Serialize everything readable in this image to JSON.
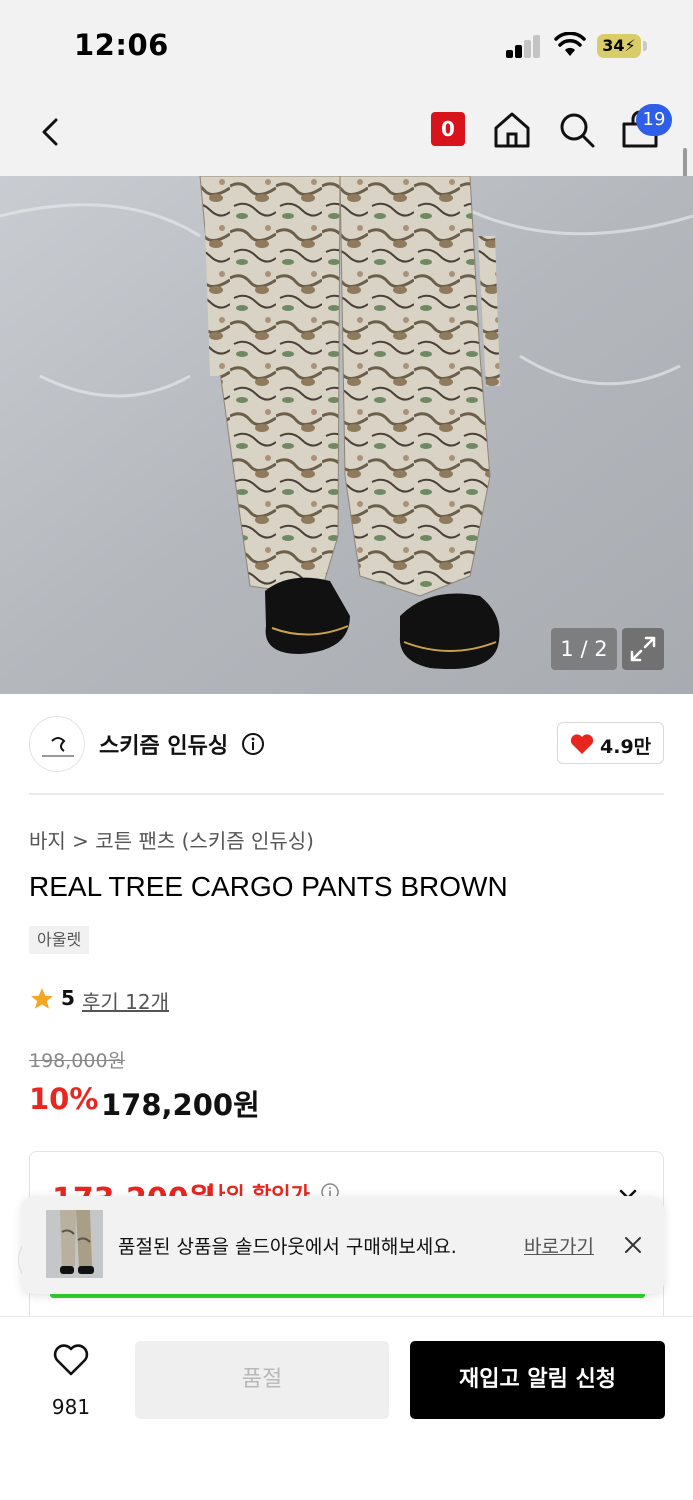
{
  "status_bar": {
    "time": "12:06",
    "battery": "34"
  },
  "header": {
    "zero_badge": "0",
    "cart_count": "19",
    "icons": [
      "back-icon",
      "zero-badge",
      "home-icon",
      "search-icon",
      "cart-icon"
    ]
  },
  "gallery": {
    "counter": "1 / 2",
    "expand_icon": "expand-icon"
  },
  "brand": {
    "name": "스키즘 인듀싱",
    "likes": "4.9만",
    "heart_color": "#e8261f"
  },
  "product": {
    "breadcrumb": [
      "바지",
      "코튼 팬츠 (스키즘 인듀싱)"
    ],
    "title": "REAL TREE CARGO PANTS BROWN",
    "tag": "아울렛",
    "rating": "5",
    "reviews": "후기 12개",
    "original_price": "198,000원",
    "discount_rate": "10%",
    "sale_price": "178,200원"
  },
  "coupon": {
    "price": "173,200원",
    "label": "나의 할인가"
  },
  "toast": {
    "message": "품절된 상품을 솔드아웃에서 구매해보세요.",
    "link": "바로가기"
  },
  "bottom_bar": {
    "wish_count": "981",
    "soldout_label": "품절",
    "restock_label": "재입고 알림 신청"
  },
  "colors": {
    "accent_red": "#e8261f",
    "badge_blue": "#2f5ee8",
    "primary_button": "#000000"
  }
}
